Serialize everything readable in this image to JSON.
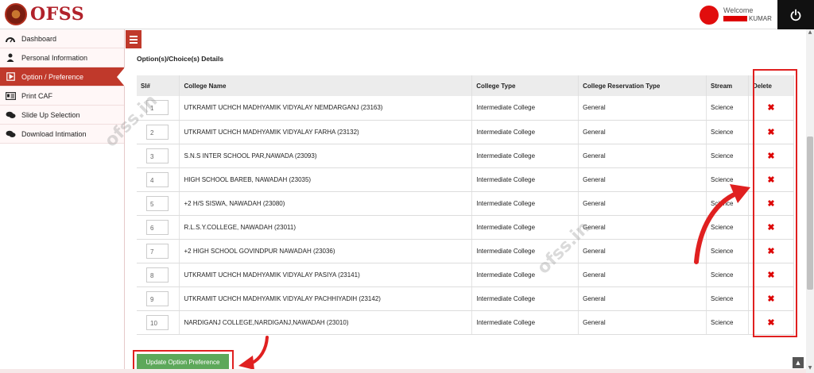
{
  "header": {
    "logo_text": "OFSS",
    "welcome": "Welcome",
    "user_name": "KUMAR"
  },
  "sidebar": {
    "items": [
      {
        "label": "Dashboard",
        "icon": "dashboard-icon",
        "active": false
      },
      {
        "label": "Personal Information",
        "icon": "user-icon",
        "active": false
      },
      {
        "label": "Option / Preference",
        "icon": "play-icon",
        "active": true
      },
      {
        "label": "Print CAF",
        "icon": "id-card-icon",
        "active": false
      },
      {
        "label": "Slide Up Selection",
        "icon": "chat-icon",
        "active": false
      },
      {
        "label": "Download Intimation",
        "icon": "chat-icon",
        "active": false
      }
    ]
  },
  "main": {
    "section_title": "Option(s)/Choice(s) Details",
    "columns": [
      "Sl#",
      "College Name",
      "College Type",
      "College Reservation Type",
      "Stream",
      "Delete"
    ],
    "rows": [
      {
        "sl": "1",
        "college": "UTKRAMIT UCHCH MADHYAMIK VIDYALAY NEMDARGANJ (23163)",
        "type": "Intermediate College",
        "reservation": "General",
        "stream": "Science"
      },
      {
        "sl": "2",
        "college": "UTKRAMIT UCHCH MADHYAMIK VIDYALAY FARHA (23132)",
        "type": "Intermediate College",
        "reservation": "General",
        "stream": "Science"
      },
      {
        "sl": "3",
        "college": "S.N.S INTER SCHOOL PAR,NAWADA (23093)",
        "type": "Intermediate College",
        "reservation": "General",
        "stream": "Science"
      },
      {
        "sl": "4",
        "college": "HIGH SCHOOL BAREB, NAWADAH (23035)",
        "type": "Intermediate College",
        "reservation": "General",
        "stream": "Science"
      },
      {
        "sl": "5",
        "college": "+2 H/S SISWA, NAWADAH (23080)",
        "type": "Intermediate College",
        "reservation": "General",
        "stream": "Science"
      },
      {
        "sl": "6",
        "college": "R.L.S.Y.COLLEGE, NAWADAH (23011)",
        "type": "Intermediate College",
        "reservation": "General",
        "stream": "Science"
      },
      {
        "sl": "7",
        "college": "+2 HIGH SCHOOL GOVINDPUR NAWADAH (23036)",
        "type": "Intermediate College",
        "reservation": "General",
        "stream": "Science"
      },
      {
        "sl": "8",
        "college": "UTKRAMIT UCHCH MADHYAMIK VIDYALAY PASIYA (23141)",
        "type": "Intermediate College",
        "reservation": "General",
        "stream": "Science"
      },
      {
        "sl": "9",
        "college": "UTKRAMIT UCHCH MADHYAMIK VIDYALAY PACHHIYADIH (23142)",
        "type": "Intermediate College",
        "reservation": "General",
        "stream": "Science"
      },
      {
        "sl": "10",
        "college": "NARDIGANJ COLLEGE,NARDIGANJ,NAWADAH (23010)",
        "type": "Intermediate College",
        "reservation": "General",
        "stream": "Science"
      }
    ],
    "delete_glyph": "✖",
    "update_button": "Update Option Preference"
  },
  "watermark": "ofss.in",
  "colors": {
    "brand": "#b1222b",
    "active": "#c0392b",
    "delete": "#dd0000",
    "button": "#5da85a",
    "annotation": "#e02020"
  }
}
